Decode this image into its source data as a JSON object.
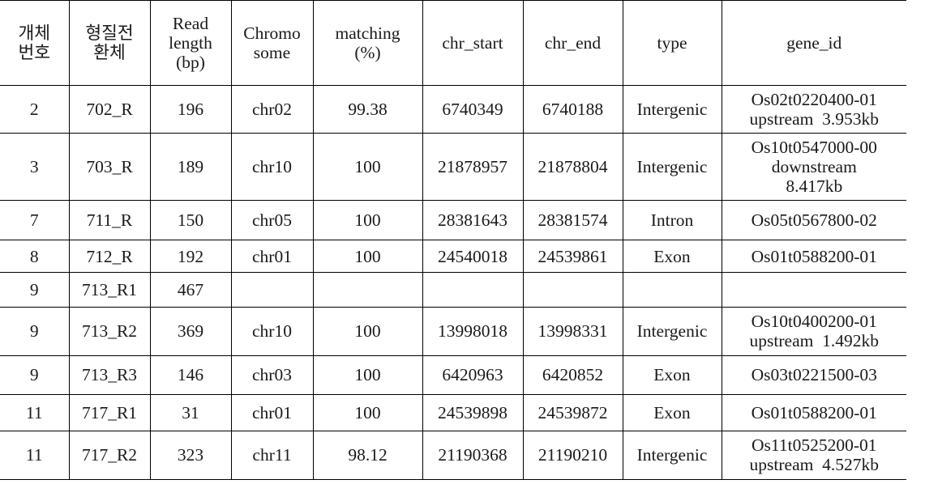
{
  "table": {
    "headers": [
      {
        "lines": [
          "개체",
          "번호"
        ]
      },
      {
        "lines": [
          "형질전",
          "환체"
        ]
      },
      {
        "lines": [
          "Read",
          "length",
          "(bp)"
        ]
      },
      {
        "lines": [
          "Chromo",
          "some"
        ]
      },
      {
        "lines": [
          "matching",
          "(%)"
        ]
      },
      {
        "lines": [
          "chr_start"
        ]
      },
      {
        "lines": [
          "chr_end"
        ]
      },
      {
        "lines": [
          "type"
        ]
      },
      {
        "lines": [
          "gene_id"
        ]
      }
    ],
    "rows": [
      {
        "no": "2",
        "transformant": "702_R",
        "read_length": "196",
        "chromosome": "chr02",
        "matching": "99.38",
        "chr_start": "6740349",
        "chr_end": "6740188",
        "type": "Intergenic",
        "gene_id_lines": [
          "Os02t0220400-01",
          "upstream  3.953kb"
        ]
      },
      {
        "no": "3",
        "transformant": "703_R",
        "read_length": "189",
        "chromosome": "chr10",
        "matching": "100",
        "chr_start": "21878957",
        "chr_end": "21878804",
        "type": "Intergenic",
        "gene_id_lines": [
          "Os10t0547000-00",
          "downstream",
          "8.417kb"
        ]
      },
      {
        "no": "7",
        "transformant": "711_R",
        "read_length": "150",
        "chromosome": "chr05",
        "matching": "100",
        "chr_start": "28381643",
        "chr_end": "28381574",
        "type": "Intron",
        "gene_id_lines": [
          "Os05t0567800-02"
        ]
      },
      {
        "no": "8",
        "transformant": "712_R",
        "read_length": "192",
        "chromosome": "chr01",
        "matching": "100",
        "chr_start": "24540018",
        "chr_end": "24539861",
        "type": "Exon",
        "gene_id_lines": [
          "Os01t0588200-01"
        ]
      },
      {
        "no": "9",
        "transformant": "713_R1",
        "read_length": "467",
        "chromosome": "",
        "matching": "",
        "chr_start": "",
        "chr_end": "",
        "type": "",
        "gene_id_lines": [
          ""
        ]
      },
      {
        "no": "9",
        "transformant": "713_R2",
        "read_length": "369",
        "chromosome": "chr10",
        "matching": "100",
        "chr_start": "13998018",
        "chr_end": "13998331",
        "type": "Intergenic",
        "gene_id_lines": [
          "Os10t0400200-01",
          "upstream  1.492kb"
        ]
      },
      {
        "no": "9",
        "transformant": "713_R3",
        "read_length": "146",
        "chromosome": "chr03",
        "matching": "100",
        "chr_start": "6420963",
        "chr_end": "6420852",
        "type": "Exon",
        "gene_id_lines": [
          "Os03t0221500-03"
        ]
      },
      {
        "no": "11",
        "transformant": "717_R1",
        "read_length": "31",
        "chromosome": "chr01",
        "matching": "100",
        "chr_start": "24539898",
        "chr_end": "24539872",
        "type": "Exon",
        "gene_id_lines": [
          "Os01t0588200-01"
        ]
      },
      {
        "no": "11",
        "transformant": "717_R2",
        "read_length": "323",
        "chromosome": "chr11",
        "matching": "98.12",
        "chr_start": "21190368",
        "chr_end": "21190210",
        "type": "Intergenic",
        "gene_id_lines": [
          "Os11t0525200-01",
          "upstream  4.527kb"
        ]
      }
    ]
  }
}
